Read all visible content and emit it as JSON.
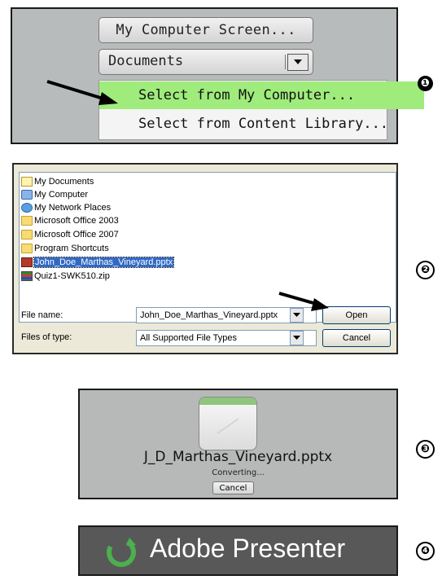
{
  "steps": {
    "one": "❶",
    "two": "❷",
    "three": "❸",
    "four": "❹"
  },
  "panel1": {
    "button_label": "My Computer Screen...",
    "combo_value": "Documents",
    "menu_items": [
      "Select from My Computer...",
      "Select from Content Library..."
    ],
    "highlight_color": "#9fec7c"
  },
  "panel2": {
    "files": [
      {
        "name": "My Documents",
        "icon": "my-documents-icon"
      },
      {
        "name": "My Computer",
        "icon": "my-computer-icon"
      },
      {
        "name": "My Network Places",
        "icon": "network-places-icon"
      },
      {
        "name": "Microsoft Office 2003",
        "icon": "folder-icon"
      },
      {
        "name": "Microsoft Office 2007",
        "icon": "folder-icon"
      },
      {
        "name": "Program Shortcuts",
        "icon": "folder-icon"
      },
      {
        "name": "John_Doe_Marthas_Vineyard.pptx",
        "icon": "powerpoint-file-icon"
      },
      {
        "name": "Quiz1-SWK510.zip",
        "icon": "zip-archive-icon"
      }
    ],
    "file_name_label": "File name:",
    "file_name_value": "John_Doe_Marthas_Vineyard.pptx",
    "files_of_type_label": "Files of type:",
    "files_of_type_value": "All Supported File Types",
    "open_label": "Open",
    "cancel_label": "Cancel"
  },
  "panel3": {
    "file_name": "J_D_Marthas_Vineyard.pptx",
    "status": "Converting...",
    "cancel_label": "Cancel"
  },
  "panel4": {
    "title": "Adobe Presenter",
    "logo_color": "#4caf50"
  }
}
